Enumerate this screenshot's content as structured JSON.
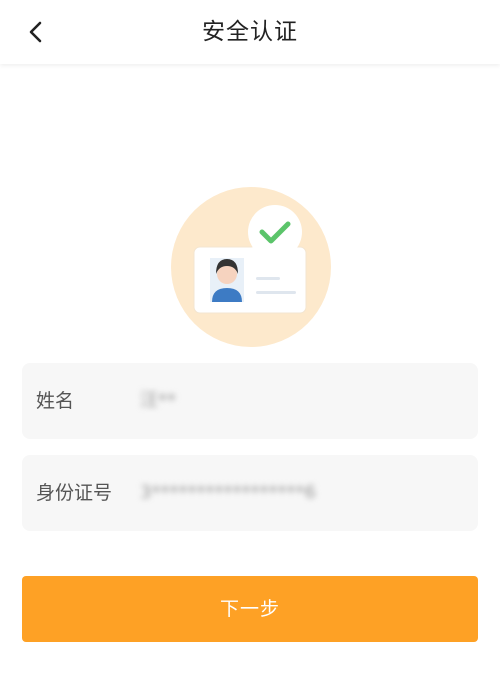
{
  "header": {
    "title": "安全认证",
    "back_icon": "chevron-left-icon"
  },
  "illustration": {
    "icon": "id-card-verified-icon",
    "badge_icon": "check-icon",
    "colors": {
      "circle": "#fde9cc",
      "check": "#5bc46a"
    }
  },
  "form": {
    "name_label": "姓名",
    "name_value": "汪**",
    "id_label": "身份证号",
    "id_value": "3*****************6"
  },
  "actions": {
    "next_label": "下一步"
  },
  "colors": {
    "accent": "#fea125",
    "field_bg": "#f7f7f7"
  }
}
